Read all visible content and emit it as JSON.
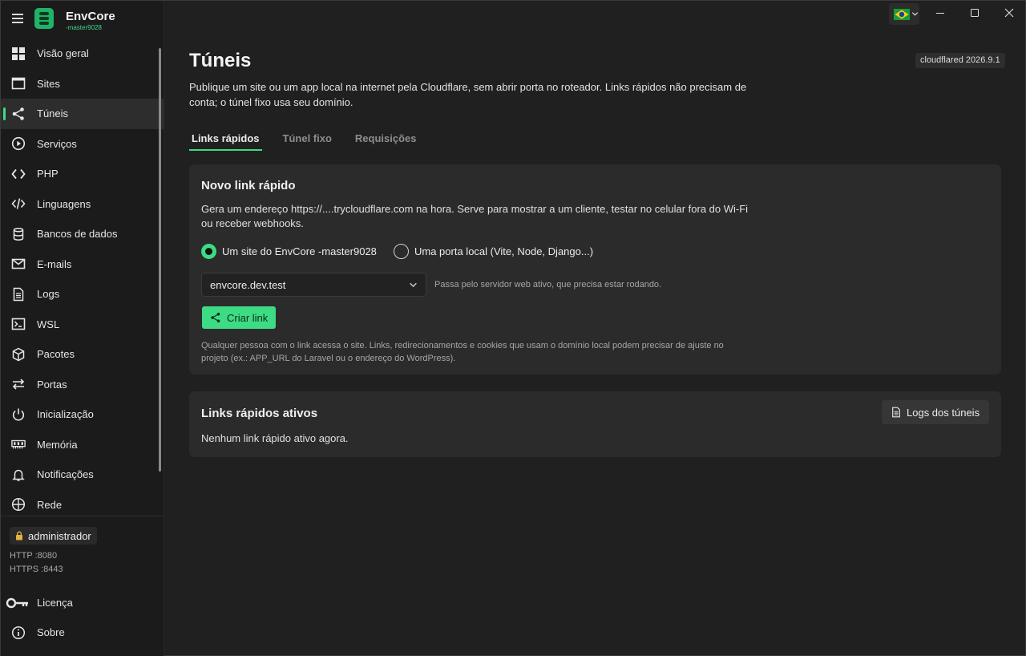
{
  "app": {
    "name": "EnvCore",
    "instance": "-master9028"
  },
  "nav": [
    {
      "label": "Visão geral",
      "icon": "grid-icon"
    },
    {
      "label": "Sites",
      "icon": "browser-window-icon"
    },
    {
      "label": "Túneis",
      "icon": "share-icon",
      "active": true
    },
    {
      "label": "Serviços",
      "icon": "play-circle-icon"
    },
    {
      "label": "PHP",
      "icon": "code-brackets-icon"
    },
    {
      "label": "Linguagens",
      "icon": "code-slash-icon"
    },
    {
      "label": "Bancos de dados",
      "icon": "database-icon"
    },
    {
      "label": "E-mails",
      "icon": "mail-icon"
    },
    {
      "label": "Logs",
      "icon": "document-icon"
    },
    {
      "label": "WSL",
      "icon": "terminal-icon"
    },
    {
      "label": "Pacotes",
      "icon": "package-icon"
    },
    {
      "label": "Portas",
      "icon": "arrows-swap-icon"
    },
    {
      "label": "Inicialização",
      "icon": "power-icon"
    },
    {
      "label": "Memória",
      "icon": "memory-chip-icon"
    },
    {
      "label": "Notificações",
      "icon": "bell-icon"
    },
    {
      "label": "Rede",
      "icon": "globe-icon"
    }
  ],
  "footer": {
    "user": "administrador",
    "http": "HTTP :8080",
    "https": "HTTPS :8443",
    "license": "Licença",
    "about": "Sobre"
  },
  "page": {
    "title": "Túneis",
    "version": "cloudflared 2026.9.1",
    "description": "Publique um site ou um app local na internet pela Cloudflare, sem abrir porta no roteador. Links rápidos não precisam de conta; o túnel fixo usa seu domínio.",
    "tabs": [
      "Links rápidos",
      "Túnel fixo",
      "Requisições"
    ]
  },
  "new_link": {
    "title": "Novo link rápido",
    "description": "Gera um endereço https://....trycloudflare.com na hora. Serve para mostrar a um cliente, testar no celular fora do Wi-Fi ou receber webhooks.",
    "option_site": "Um site do EnvCore -master9028",
    "option_port": "Uma porta local (Vite, Node, Django...)",
    "selected_site": "envcore.dev.test",
    "select_hint": "Passa pelo servidor web ativo, que precisa estar rodando.",
    "create_button": "Criar link",
    "note": "Qualquer pessoa com o link acessa o site. Links, redirecionamentos e cookies que usam o domínio local podem precisar de ajuste no projeto (ex.: APP_URL do Laravel ou o endereço do WordPress)."
  },
  "active_links": {
    "title": "Links rápidos ativos",
    "logs_button": "Logs dos túneis",
    "empty": "Nenhum link rápido ativo agora."
  },
  "colors": {
    "accent": "#3ddc84",
    "background": "#202020",
    "sidebar": "#1b1b1b",
    "card": "#2b2b2b"
  }
}
